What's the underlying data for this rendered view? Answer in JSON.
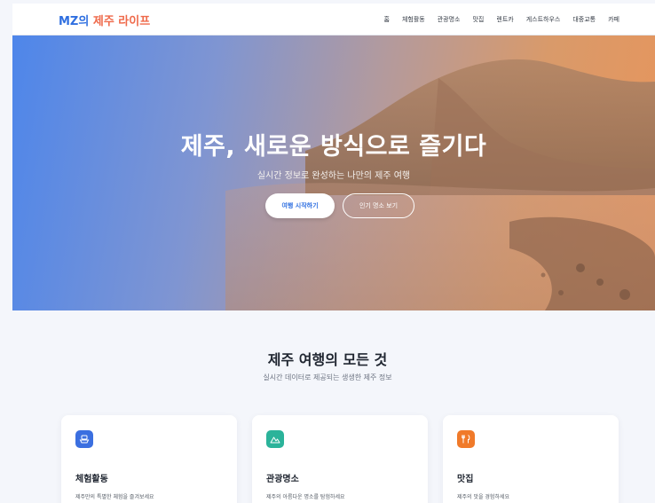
{
  "header": {
    "logo_prefix": "MZ의",
    "logo_accent": "제주 라이프",
    "nav": [
      "홈",
      "체험활동",
      "관광명소",
      "맛집",
      "렌트카",
      "게스트하우스",
      "대중교통",
      "카페"
    ]
  },
  "hero": {
    "title": "제주, 새로운 방식으로 즐기다",
    "subtitle": "실시간 정보로 완성하는 나만의 제주 여행",
    "primary_button": "여행 시작하기",
    "secondary_button": "인기 명소 보기"
  },
  "section": {
    "title": "제주 여행의 모든 것",
    "subtitle": "실시간 데이터로 제공되는 생생한 제주 정보"
  },
  "cards": [
    {
      "icon": "ship-icon",
      "color": "#3b6fe0",
      "title": "체험활동",
      "desc": "제주만의 특별한 체험을 즐겨보세요"
    },
    {
      "icon": "mountain-icon",
      "color": "#2bb39a",
      "title": "관광명소",
      "desc": "제주의 아름다운 명소를 탐험하세요"
    },
    {
      "icon": "fork-knife-icon",
      "color": "#f07a2a",
      "title": "맛집",
      "desc": "제주의 맛을 경험하세요"
    }
  ],
  "colors": {
    "brand": "#2f6fe0",
    "accent": "#ef6a4b",
    "background": "#f4f6fb"
  }
}
